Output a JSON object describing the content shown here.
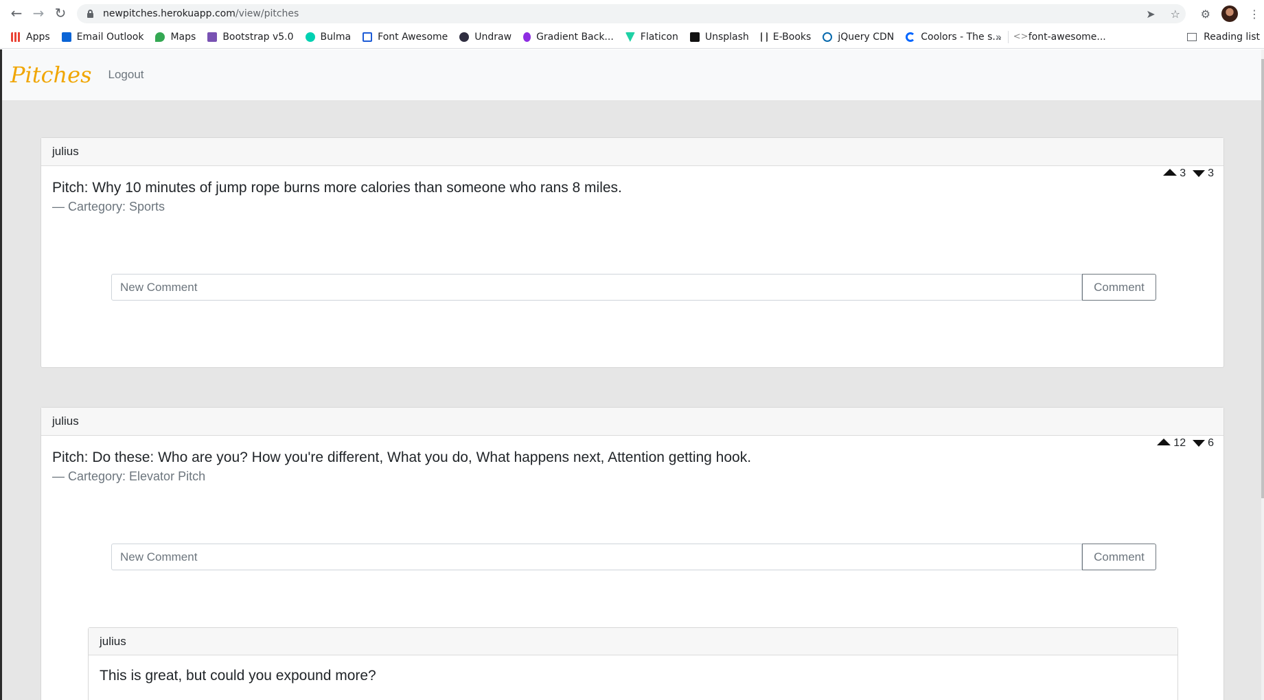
{
  "browser": {
    "url_host": "newpitches.herokuapp.com",
    "url_path": "/view/pitches",
    "bookmarks": [
      {
        "label": "Apps",
        "color": "#4285f4"
      },
      {
        "label": "Email Outlook",
        "color": "#0a64d6"
      },
      {
        "label": "Maps",
        "color": "#34a853"
      },
      {
        "label": "Bootstrap v5.0",
        "color": "#7952b3"
      },
      {
        "label": "Bulma",
        "color": "#00d1b2"
      },
      {
        "label": "Font Awesome",
        "color": "#1c5bd6"
      },
      {
        "label": "Undraw",
        "color": "#2f2e41"
      },
      {
        "label": "Gradient Back...",
        "color": "#8e2de2"
      },
      {
        "label": "Flaticon",
        "color": "#1fd1a5"
      },
      {
        "label": "Unsplash",
        "color": "#111111"
      },
      {
        "label": "E-Books",
        "color": "#555555"
      },
      {
        "label": "jQuery CDN",
        "color": "#0769ad"
      },
      {
        "label": "Coolors - The s...",
        "color": "#0066ff"
      },
      {
        "label": "font-awesome...",
        "color": "#888888"
      }
    ],
    "more": "»",
    "reading_list": "Reading list"
  },
  "navbar": {
    "brand": "Pitches",
    "logout": "Logout"
  },
  "pitches": [
    {
      "author": "julius",
      "text": "Pitch: Why 10 minutes of jump rope burns more calories than someone who rans 8 miles.",
      "category": "— Cartegory: Sports",
      "upvotes": "3",
      "downvotes": "3",
      "comment_placeholder": "New Comment",
      "comment_button": "Comment"
    },
    {
      "author": "julius",
      "text": "Pitch: Do these: Who are you? How you're different, What you do, What happens next, Attention getting hook.",
      "category": "— Cartegory: Elevator Pitch",
      "upvotes": "12",
      "downvotes": "6",
      "comment_placeholder": "New Comment",
      "comment_button": "Comment",
      "comments": [
        {
          "author": "julius",
          "text": "This is great, but could you expound more?"
        }
      ]
    }
  ],
  "colors": {
    "brand": "#f0a500",
    "page_bg": "#e6e6e6"
  }
}
